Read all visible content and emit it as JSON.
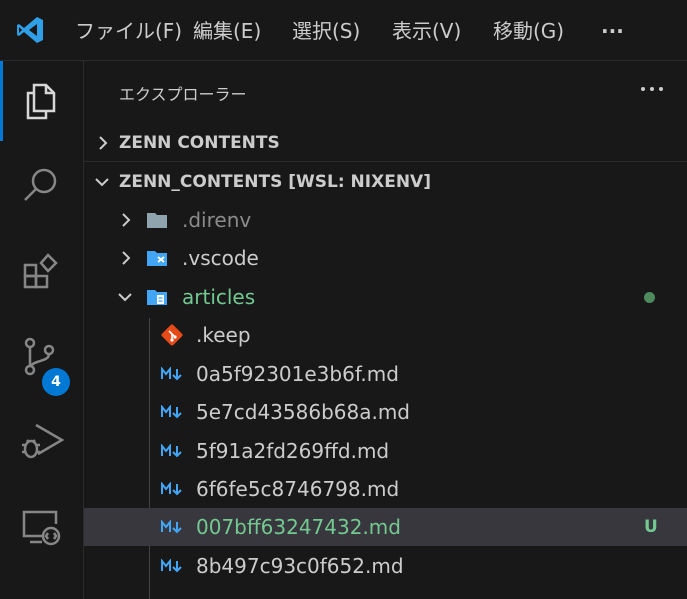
{
  "menu": {
    "file": "ファイル(F)",
    "edit": "編集(E)",
    "selection": "選択(S)",
    "view": "表示(V)",
    "go": "移動(G)",
    "more": "···"
  },
  "activity": {
    "source_control_badge": "4"
  },
  "explorer": {
    "title": "エクスプローラー",
    "sections": {
      "collapsed_title": "ZENN CONTENTS",
      "workspace_title": "ZENN_CONTENTS [WSL: NIXENV]"
    },
    "tree": [
      {
        "name": ".direnv",
        "type": "folder"
      },
      {
        "name": ".vscode",
        "type": "folder-vscode"
      },
      {
        "name": "articles",
        "type": "folder-open",
        "status": "modified-dot"
      },
      {
        "name": ".keep",
        "type": "git-file"
      },
      {
        "name": "0a5f92301e3b6f.md",
        "type": "markdown"
      },
      {
        "name": "5e7cd43586b68a.md",
        "type": "markdown"
      },
      {
        "name": "5f91a2fd269ffd.md",
        "type": "markdown"
      },
      {
        "name": "6f6fe5c8746798.md",
        "type": "markdown"
      },
      {
        "name": "007bff63247432.md",
        "type": "markdown",
        "status": "U",
        "selected": true
      },
      {
        "name": "8b497c93c0f652.md",
        "type": "markdown"
      }
    ]
  },
  "colors": {
    "accent": "#0078d4",
    "untracked": "#73c991",
    "background": "#181818"
  }
}
